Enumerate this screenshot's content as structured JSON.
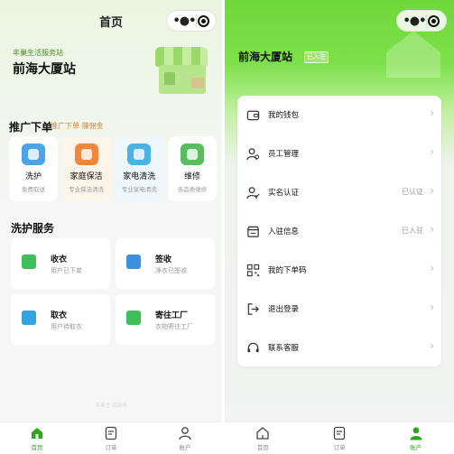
{
  "left": {
    "title": "首页",
    "station": {
      "subtitle": "丰巢生活服务站",
      "name": "前海大厦站"
    },
    "promo": {
      "section_title": "推广下单",
      "tag": "推广下单 赚佣金",
      "items": [
        {
          "name": "洗护",
          "sub": "免费取送",
          "color": "#4aa4e8"
        },
        {
          "name": "家庭保洁",
          "sub": "专业保洁清洗",
          "color": "#f2863a"
        },
        {
          "name": "家电清洗",
          "sub": "专业家电清洗",
          "color": "#4bb2e3"
        },
        {
          "name": "维修",
          "sub": "各品类维修",
          "color": "#58bd5c"
        }
      ]
    },
    "service": {
      "section_title": "洗护服务",
      "items": [
        {
          "name": "收衣",
          "sub": "用户已下单",
          "color": "#3fbf5a"
        },
        {
          "name": "签收",
          "sub": "净衣已签收",
          "color": "#3d8fe0"
        },
        {
          "name": "取衣",
          "sub": "用户待取衣",
          "color": "#34a3e0"
        },
        {
          "name": "寄往工厂",
          "sub": "衣物寄往工厂",
          "color": "#3fbf5a"
        }
      ]
    },
    "footer_text": "丰巢生活服务",
    "tabs": [
      {
        "label": "首页",
        "active": true
      },
      {
        "label": "订单",
        "active": false
      },
      {
        "label": "账户",
        "active": false
      }
    ]
  },
  "right": {
    "station": {
      "name": "前海大厦站",
      "badge": "已入驻"
    },
    "menu": [
      {
        "label": "我的钱包",
        "status": "",
        "icon": "wallet-icon"
      },
      {
        "label": "员工管理",
        "status": "",
        "icon": "staff-icon"
      },
      {
        "label": "实名认证",
        "status": "已认证",
        "icon": "id-verify-icon"
      },
      {
        "label": "入驻信息",
        "status": "已入驻",
        "icon": "store-info-icon"
      },
      {
        "label": "我的下单码",
        "status": "",
        "icon": "qr-code-icon"
      },
      {
        "label": "退出登录",
        "status": "",
        "icon": "logout-icon"
      },
      {
        "label": "联系客服",
        "status": "",
        "icon": "headset-icon"
      }
    ],
    "tabs": [
      {
        "label": "首页",
        "active": false
      },
      {
        "label": "订单",
        "active": false
      },
      {
        "label": "账户",
        "active": true
      }
    ]
  },
  "colors": {
    "accent": "#2ba61e",
    "promo_tag": "#f0821e",
    "header_green": "#72d93e"
  }
}
